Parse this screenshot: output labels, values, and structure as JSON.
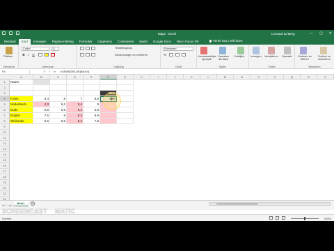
{
  "window": {
    "title": "Map1 - Excel",
    "user": "Leonard ad Berg",
    "controls": [
      "—",
      "▢",
      "✕"
    ]
  },
  "tabs": [
    "Bestand",
    "Start",
    "Invoegen",
    "Pagina-indeling",
    "Formules",
    "Gegevens",
    "Controleren",
    "Beeld",
    "Google Docs",
    "Micro Focus Filr"
  ],
  "tell_me": "Vertel wat u wilt doen",
  "ribbon": {
    "clipboard": {
      "label": "Klembord",
      "paste": "Plakken"
    },
    "font": {
      "label": "Lettertype",
      "name": "Calibri",
      "size": "11",
      "bold": "B",
      "italic": "I",
      "underline": "U"
    },
    "alignment": {
      "label": "Uitlijning",
      "wrap": "Tekstterugloop",
      "merge": "Samenvoegen en centreren"
    },
    "number": {
      "label": "Getal",
      "format": "Standaard",
      "percent": "%"
    },
    "styles": {
      "label": "Stijlen",
      "cond": "Voorwaardelijke opmaak",
      "table": "Opmaken als tabel",
      "cell": "Celstijlen"
    },
    "cells": {
      "label": "Cellen",
      "insert": "Invoegen",
      "delete": "Verwijderen",
      "format": "Opmaak"
    },
    "editing": {
      "label": "Bewerken",
      "sort": "Sorteren en filteren",
      "find": "Zoeken en selecteren"
    }
  },
  "formula_bar": {
    "name_box": "F4",
    "fx": "fx",
    "content": "=GEMIDDELDE(B4:E4)"
  },
  "columns": [
    "A",
    "B",
    "C",
    "D",
    "E",
    "F",
    "G",
    "H",
    "I",
    "J",
    "K",
    "L",
    "M",
    "N",
    "O",
    "P",
    "Q",
    "R",
    "S"
  ],
  "rows": [
    [
      "Naam:",
      "",
      "",
      "",
      "",
      "",
      ""
    ],
    [
      "",
      "",
      "",
      "",
      "",
      "",
      ""
    ],
    [
      "",
      "",
      "",
      "",
      "",
      "GEM",
      ""
    ],
    [
      "Frans",
      "6,4",
      "8",
      "7",
      "6,6",
      "6,98",
      ""
    ],
    [
      "Nederlands",
      "4,3",
      "6,2",
      "5,4",
      "8",
      "",
      ""
    ],
    [
      "Duits",
      "5,6",
      "5,5",
      "5,4",
      "5,8",
      "",
      ""
    ],
    [
      "Engels",
      "7,5",
      "9",
      "5,4",
      "8,9",
      "",
      ""
    ],
    [
      "Wiskunde",
      "5,6",
      "6,5",
      "5,4",
      "7,8",
      "",
      ""
    ]
  ],
  "row_numbers": [
    "1",
    "2",
    "3",
    "4",
    "5",
    "6",
    "7",
    "8",
    "9",
    "10",
    "11",
    "12",
    "13",
    "14",
    "15",
    "16",
    "17",
    "18",
    "19",
    "20",
    "21",
    "22"
  ],
  "sheet": {
    "tab": "Blad1",
    "add": "+",
    "nav": "◀ ▶"
  },
  "status": {
    "text": "Gereed",
    "zoom": "100%"
  },
  "watermark": {
    "small": "RECORDED WITH",
    "big": "SCREENCAST",
    "suffix": "MATIC"
  },
  "colors": {
    "excel_green": "#217346",
    "yellow": "#ffff00",
    "pink": "#ffc7ce",
    "dark": "#3b3b3b"
  }
}
